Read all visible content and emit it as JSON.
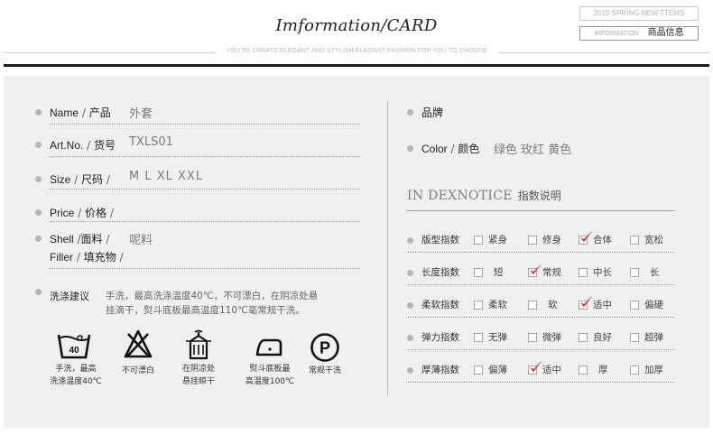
{
  "header": {
    "title": "Imformation/CARD",
    "subtitle": "YOU TO CREATE ELEGANT AND STYLISH ELEGANT FASHION FOR YOU TO CHOOSE",
    "season_tag": "2015 SPRING  NEW TTEMS",
    "info_en": "IMFORMATION",
    "info_cn": "商品信息"
  },
  "left": {
    "name": {
      "label_en": "Name",
      "label_cn": "产品",
      "value": "外套"
    },
    "artno": {
      "label_en": "Art.No.",
      "label_cn": "货号",
      "value": "TXLS01"
    },
    "size": {
      "label_en": "Size",
      "label_cn": "尺码",
      "value": "M L XL XXL"
    },
    "price": {
      "label_en": "Price",
      "label_cn": "价格",
      "value": ""
    },
    "shell": {
      "label_en": "Shell",
      "label_cn": "面料",
      "value": "呢料"
    },
    "filler": {
      "label_en": "Filler",
      "label_cn": "填充物",
      "value": ""
    },
    "care": {
      "title": "洗涤建议",
      "line1": "手洗，最高洗涤温度40℃，不可漂白，在阴凉处悬",
      "line2": "挂滴干，熨斗底板最高温度110℃毫常规干洗。"
    },
    "care_icons": [
      {
        "icon": "hand-wash-40-icon",
        "temp": "40",
        "caption1": "手洗，最高",
        "caption2": "洗涤温度40℃"
      },
      {
        "icon": "no-bleach-icon",
        "caption1": "不可漂白",
        "caption2": ""
      },
      {
        "icon": "shade-drip-dry-icon",
        "caption1": "在阴凉处",
        "caption2": "悬挂晾干"
      },
      {
        "icon": "iron-icon",
        "caption1": "熨斗底板最",
        "caption2": "高温度100℃"
      },
      {
        "icon": "dry-clean-p-icon",
        "letter": "P",
        "caption1": "常规干洗",
        "caption2": ""
      }
    ]
  },
  "right": {
    "brand": {
      "label_cn": "品牌",
      "value": ""
    },
    "color": {
      "label_en": "Color",
      "label_cn": "颜色",
      "value": "绿色 玫红 黄色"
    },
    "notice": {
      "title_en": "IN DEXNOTICE",
      "title_cn": "指数说明"
    },
    "indices": [
      {
        "label": "版型指数",
        "options": [
          "紧身",
          "修身",
          "合体",
          "宽松"
        ],
        "selected": 2
      },
      {
        "label": "长度指数",
        "options": [
          "短",
          "常规",
          "中长",
          "长"
        ],
        "selected": 1
      },
      {
        "label": "柔软指数",
        "options": [
          "柔软",
          "软",
          "适中",
          "偏硬"
        ],
        "selected": 2
      },
      {
        "label": "弹力指数",
        "options": [
          "无弹",
          "微弹",
          "良好",
          "超弹"
        ],
        "selected": -1
      },
      {
        "label": "厚薄指数",
        "options": [
          "偏薄",
          "适中",
          "厚",
          "加厚"
        ],
        "selected": 1
      }
    ],
    "check_color": "#e0261c"
  }
}
